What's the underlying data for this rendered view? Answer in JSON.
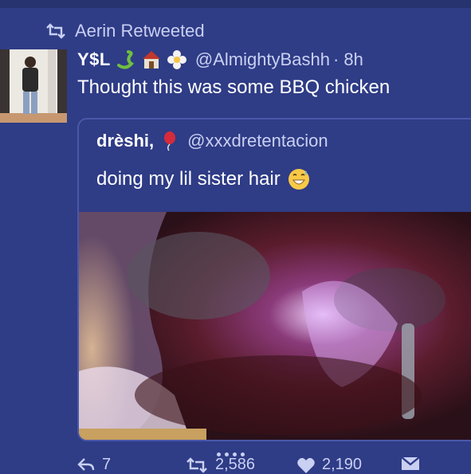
{
  "retweet_header": {
    "label": "Aerin Retweeted"
  },
  "tweet": {
    "author_name": "Y$L",
    "handle": "@AlmightyBashh",
    "time": "· 8h",
    "text": "Thought this was some BBQ chicken",
    "name_emojis": [
      "snake-emoji",
      "house-emoji",
      "flower-emoji"
    ]
  },
  "quoted_tweet": {
    "author_name": "drèshi,",
    "name_emoji": "balloon-emoji",
    "handle": "@xxxdretentacion",
    "text": "doing my lil sister hair",
    "text_emoji": "grinning-sweat-emoji"
  },
  "actions": {
    "reply_count": "7",
    "retweet_count": "2,586",
    "like_count": "2,190"
  },
  "colors": {
    "background": "#2f3c86",
    "secondary_text": "#c9d0f2",
    "border": "#4a58a8"
  }
}
